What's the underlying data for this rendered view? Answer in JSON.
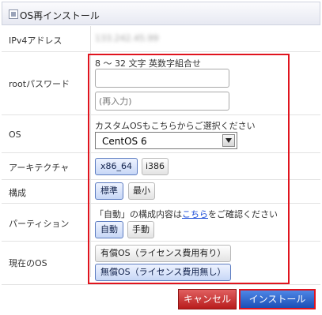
{
  "header": {
    "title": "OS再インストール"
  },
  "rows": {
    "ipv4": {
      "label": "IPv4アドレス",
      "value": "133.242.45.99"
    },
    "root_password": {
      "label": "rootパスワード",
      "hint": "8 ～ 32 文字 英数字組合せ",
      "password_value": "",
      "confirm_placeholder": "(再入力)"
    },
    "os": {
      "label": "OS",
      "hint": "カスタムOSもこちらからご選択ください",
      "selected": "CentOS 6"
    },
    "architecture": {
      "label": "アーキテクチャ",
      "options": [
        "x86_64",
        "i386"
      ],
      "selected": "x86_64"
    },
    "configuration": {
      "label": "構成",
      "options": [
        "標準",
        "最小"
      ],
      "selected": "標準"
    },
    "partition": {
      "label": "パーティション",
      "hint_prefix": "「自動」の構成内容は",
      "hint_link": "こちら",
      "hint_suffix": "をご確認ください",
      "options": [
        "自動",
        "手動"
      ],
      "selected": "自動"
    },
    "current_os": {
      "label": "現在のOS",
      "options": [
        "有償OS（ライセンス費用有り）",
        "無償OS（ライセンス費用無し）"
      ],
      "selected": "無償OS（ライセンス費用無し）"
    }
  },
  "actions": {
    "cancel": "キャンセル",
    "install": "インストール"
  },
  "colors": {
    "highlight": "#e0141e",
    "cancel": "#c62828",
    "install": "#2a5fd0",
    "link": "#1a4bd8"
  }
}
